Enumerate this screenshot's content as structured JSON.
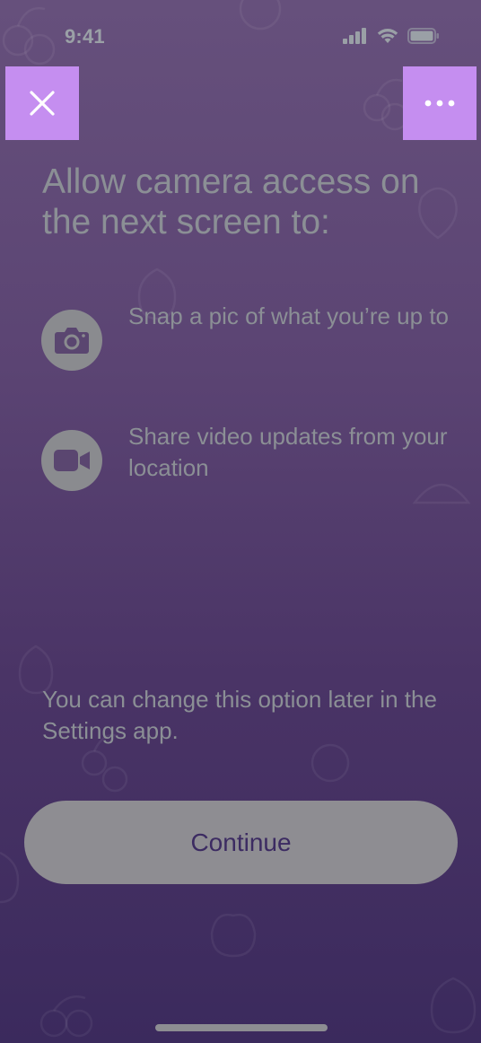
{
  "status_bar": {
    "time": "9:41",
    "icons": [
      "cellular-signal-icon",
      "wifi-icon",
      "battery-icon"
    ]
  },
  "toolbar": {
    "close_icon": "close-icon",
    "more_icon": "more-horizontal-icon"
  },
  "headline": "Allow camera access on the next screen to:",
  "features": [
    {
      "icon": "camera-icon",
      "text": "Snap a pic of what you’re up to"
    },
    {
      "icon": "video-camera-icon",
      "text": "Share video updates from your location"
    }
  ],
  "footnote": "You can change this option later in the Settings app.",
  "continue_label": "Continue",
  "colors": {
    "accent_button": "#c58ef0",
    "continue_text": "#3c2b62",
    "background_top": "#66507c",
    "background_bottom": "#3b2a5d"
  }
}
